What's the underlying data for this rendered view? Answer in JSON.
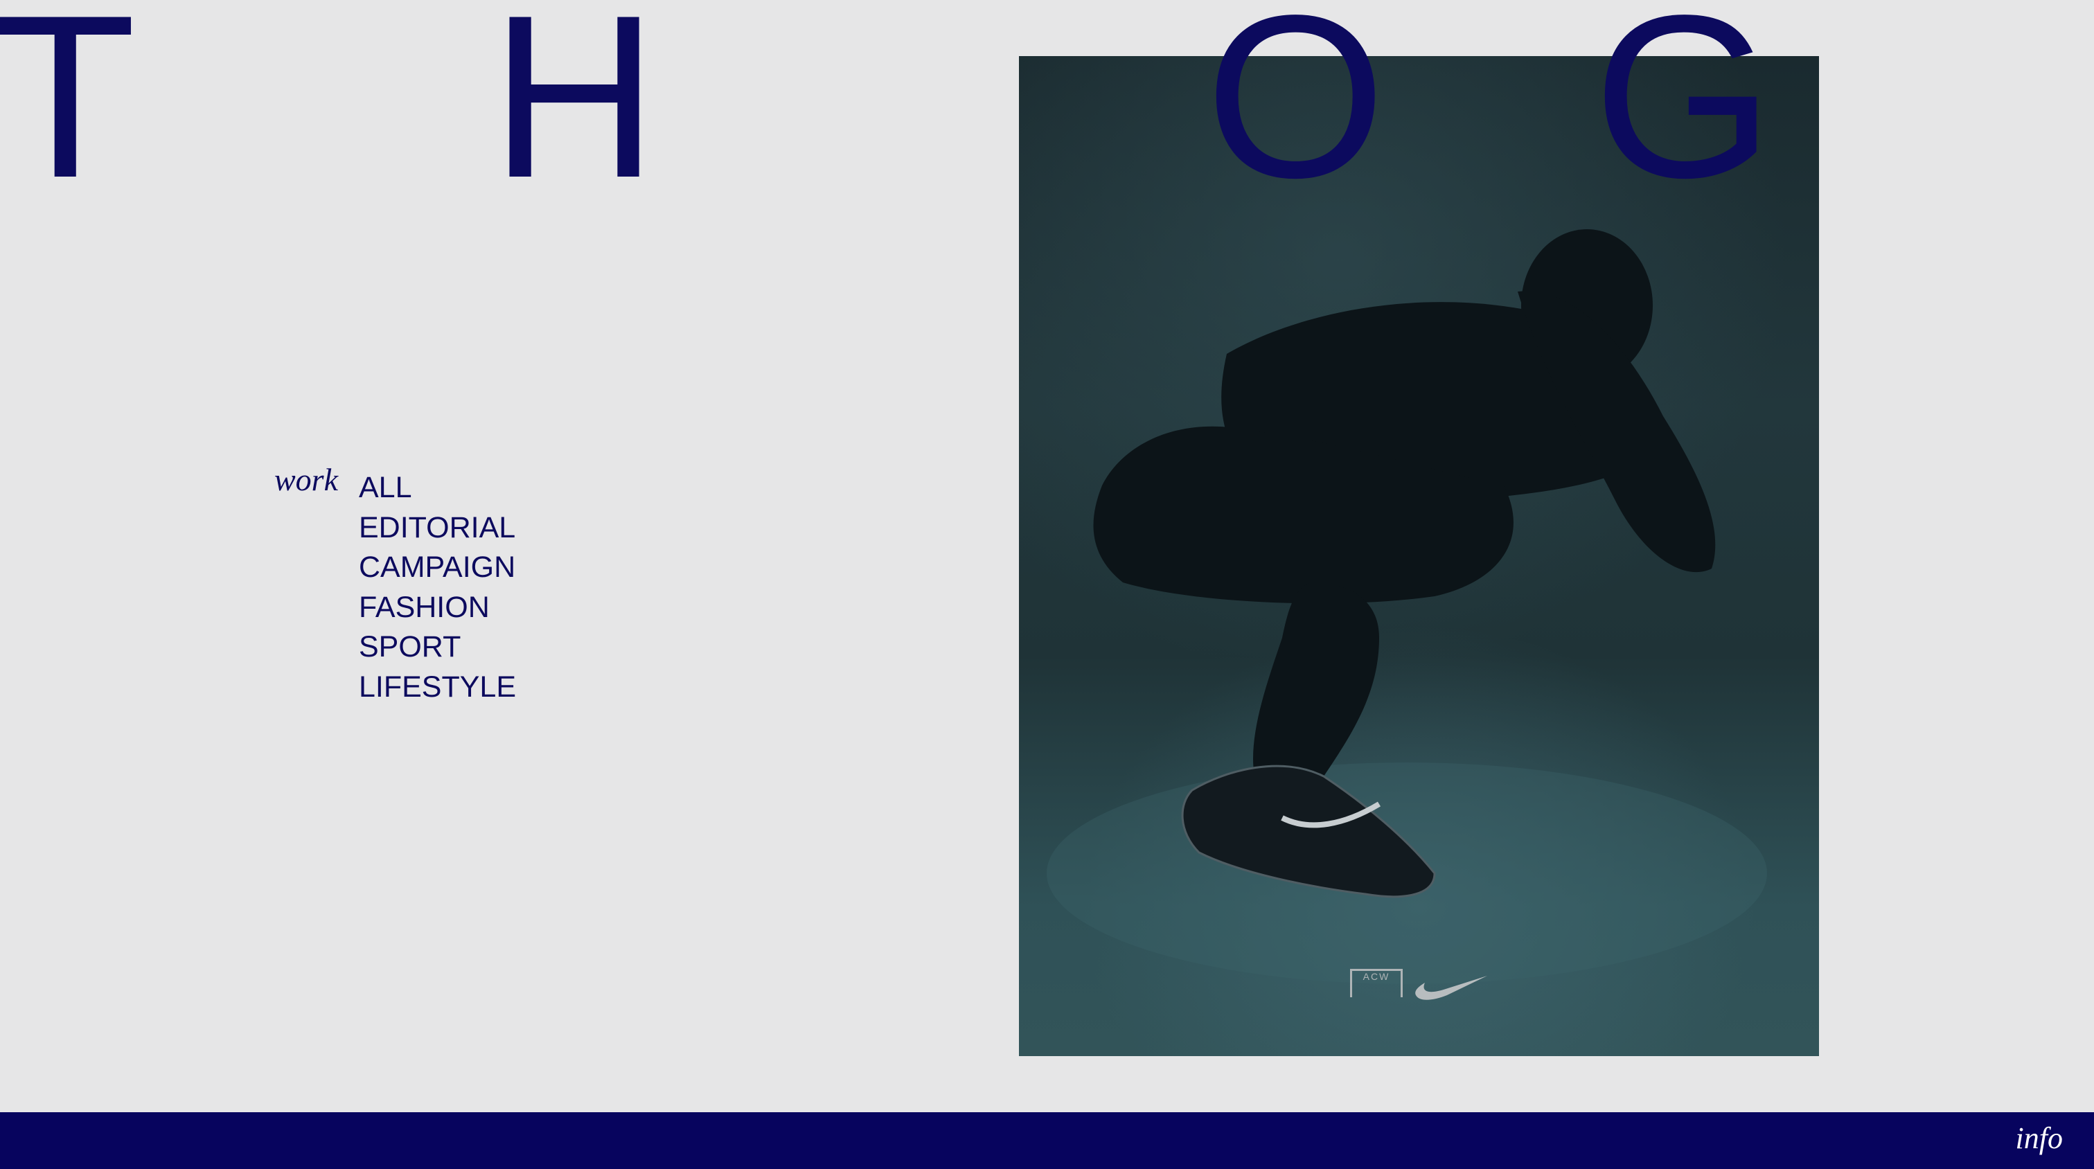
{
  "brand": {
    "letters": [
      "T",
      "H",
      "O",
      "G"
    ]
  },
  "colors": {
    "accent": "#0c0a5e",
    "background": "#e6e6e7",
    "footer": "#07045e"
  },
  "work": {
    "label": "work",
    "items": [
      "ALL",
      "EDITORIAL",
      "CAMPAIGN",
      "FASHION",
      "SPORT",
      "LIFESTYLE"
    ]
  },
  "hero": {
    "logo_text": "ACW"
  },
  "footer": {
    "info_label": "info"
  }
}
